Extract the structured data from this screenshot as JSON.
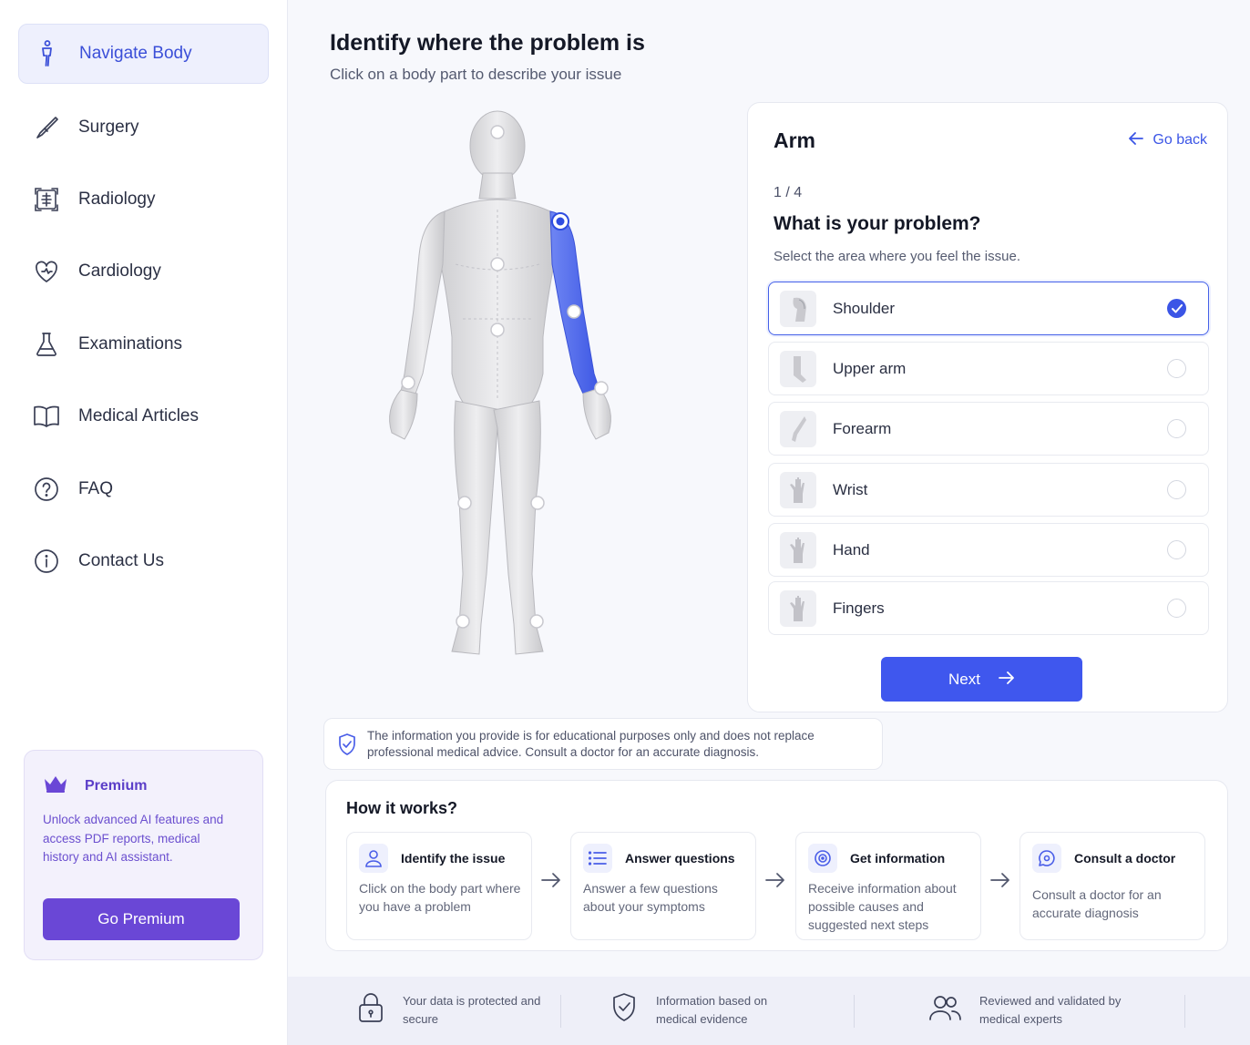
{
  "sidebar": {
    "items": [
      {
        "label": "Navigate Body",
        "icon": "person-icon",
        "active": true
      },
      {
        "label": "Surgery",
        "icon": "scalpel-icon"
      },
      {
        "label": "Radiology",
        "icon": "xray-icon"
      },
      {
        "label": "Cardiology",
        "icon": "heart-icon"
      },
      {
        "label": "Examinations",
        "icon": "flask-icon"
      },
      {
        "label": "Medical Articles",
        "icon": "book-icon"
      },
      {
        "label": "FAQ",
        "icon": "question-icon"
      },
      {
        "label": "Contact Us",
        "icon": "info-icon"
      }
    ],
    "premium": {
      "title": "Premium",
      "text": "Unlock advanced AI features and access PDF reports, medical history and AI assistant.",
      "button": "Go Premium"
    }
  },
  "header": {
    "title": "Identify where the problem is",
    "subtitle": "Click on a body part to describe your issue"
  },
  "panel": {
    "title": "Arm",
    "go_back": "Go back",
    "step": "1 / 4",
    "question": "What is your problem?",
    "hint": "Select the area where you feel the issue.",
    "options": [
      {
        "label": "Shoulder",
        "selected": true
      },
      {
        "label": "Upper arm",
        "selected": false
      },
      {
        "label": "Forearm",
        "selected": false
      },
      {
        "label": "Wrist",
        "selected": false
      },
      {
        "label": "Hand",
        "selected": false
      },
      {
        "label": "Fingers",
        "selected": false
      }
    ],
    "next": "Next"
  },
  "disclaimer": "The information you provide is for educational purposes only and does not replace professional medical advice. Consult a doctor for an accurate diagnosis.",
  "how": {
    "title": "How it works?",
    "steps": [
      {
        "title": "Identify the issue",
        "desc": "Click on the body part where you have a problem",
        "icon": "user-icon"
      },
      {
        "title": "Answer questions",
        "desc": "Answer a few questions about your symptoms",
        "icon": "list-icon"
      },
      {
        "title": "Get information",
        "desc": "Receive information about possible causes and suggested next steps",
        "icon": "target-icon"
      },
      {
        "title": "Consult a doctor",
        "desc": "Consult a doctor for an accurate diagnosis",
        "icon": "chat-icon"
      }
    ]
  },
  "footer": [
    {
      "text": "Your data is protected and secure",
      "icon": "lock-icon"
    },
    {
      "text": "Information based on medical evidence",
      "icon": "shield-check-icon"
    },
    {
      "text": "Reviewed and validated by medical experts",
      "icon": "users-icon"
    }
  ],
  "colors": {
    "accent": "#3f57ee",
    "premium": "#6a47d6",
    "highlight": "#4a63e8"
  }
}
